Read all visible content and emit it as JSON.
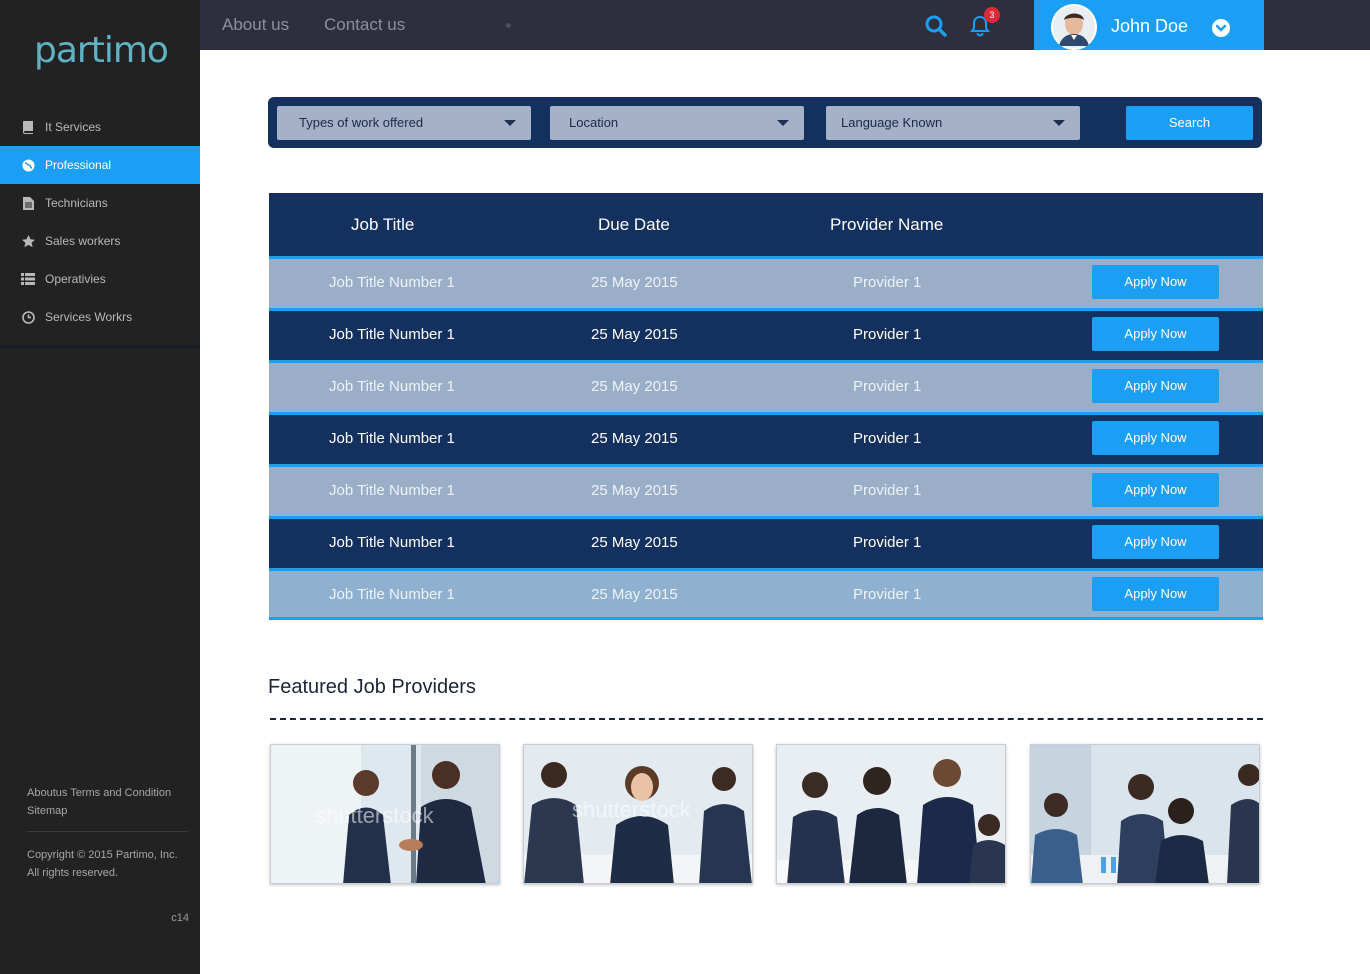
{
  "brand": {
    "logo_text": "partimo"
  },
  "sidebar": {
    "items": [
      {
        "label": "It Services",
        "icon": "book-icon",
        "active": false
      },
      {
        "label": "Professional",
        "icon": "globe-icon",
        "active": true
      },
      {
        "label": "Technicians",
        "icon": "document-icon",
        "active": false
      },
      {
        "label": "Sales workers",
        "icon": "star-icon",
        "active": false
      },
      {
        "label": "Operativies",
        "icon": "list-icon",
        "active": false
      },
      {
        "label": "Services Workrs",
        "icon": "clock-icon",
        "active": false
      }
    ],
    "footer_links": "Aboutus Terms and Condition Sitemap",
    "copyright": "Copyright © 2015 Partimo, Inc. All rights reserved.",
    "version": "c14"
  },
  "topbar": {
    "links": [
      "About us",
      "Contact us"
    ],
    "notification_count": "3",
    "user_name": "John Doe"
  },
  "filters": {
    "work_type": "Types of work offered",
    "location": "Location",
    "language": "Language Known",
    "search_label": "Search"
  },
  "table": {
    "headers": [
      "Job Title",
      "Due Date",
      "Provider Name"
    ],
    "rows": [
      {
        "title": "Job Title Number 1",
        "date": "25 May 2015",
        "provider": "Provider 1",
        "action": "Apply Now"
      },
      {
        "title": "Job Title Number 1",
        "date": "25 May 2015",
        "provider": "Provider 1",
        "action": "Apply Now"
      },
      {
        "title": "Job Title Number 1",
        "date": "25 May 2015",
        "provider": "Provider 1",
        "action": "Apply Now"
      },
      {
        "title": "Job Title Number 1",
        "date": "25 May 2015",
        "provider": "Provider 1",
        "action": "Apply Now"
      },
      {
        "title": "Job Title Number 1",
        "date": "25 May 2015",
        "provider": "Provider 1",
        "action": "Apply Now"
      },
      {
        "title": "Job Title Number 1",
        "date": "25 May 2015",
        "provider": "Provider 1",
        "action": "Apply Now"
      },
      {
        "title": "Job Title Number 1",
        "date": "25 May 2015",
        "provider": "Provider 1",
        "action": "Apply Now"
      }
    ]
  },
  "featured": {
    "title": "Featured Job Providers",
    "watermark": "shutterstock"
  },
  "colors": {
    "accent": "#1a9ff4",
    "navy": "#14305e",
    "row_light": "#9aaec8",
    "sidebar_bg": "#222222",
    "topbar_bg": "#2d2f3d"
  }
}
